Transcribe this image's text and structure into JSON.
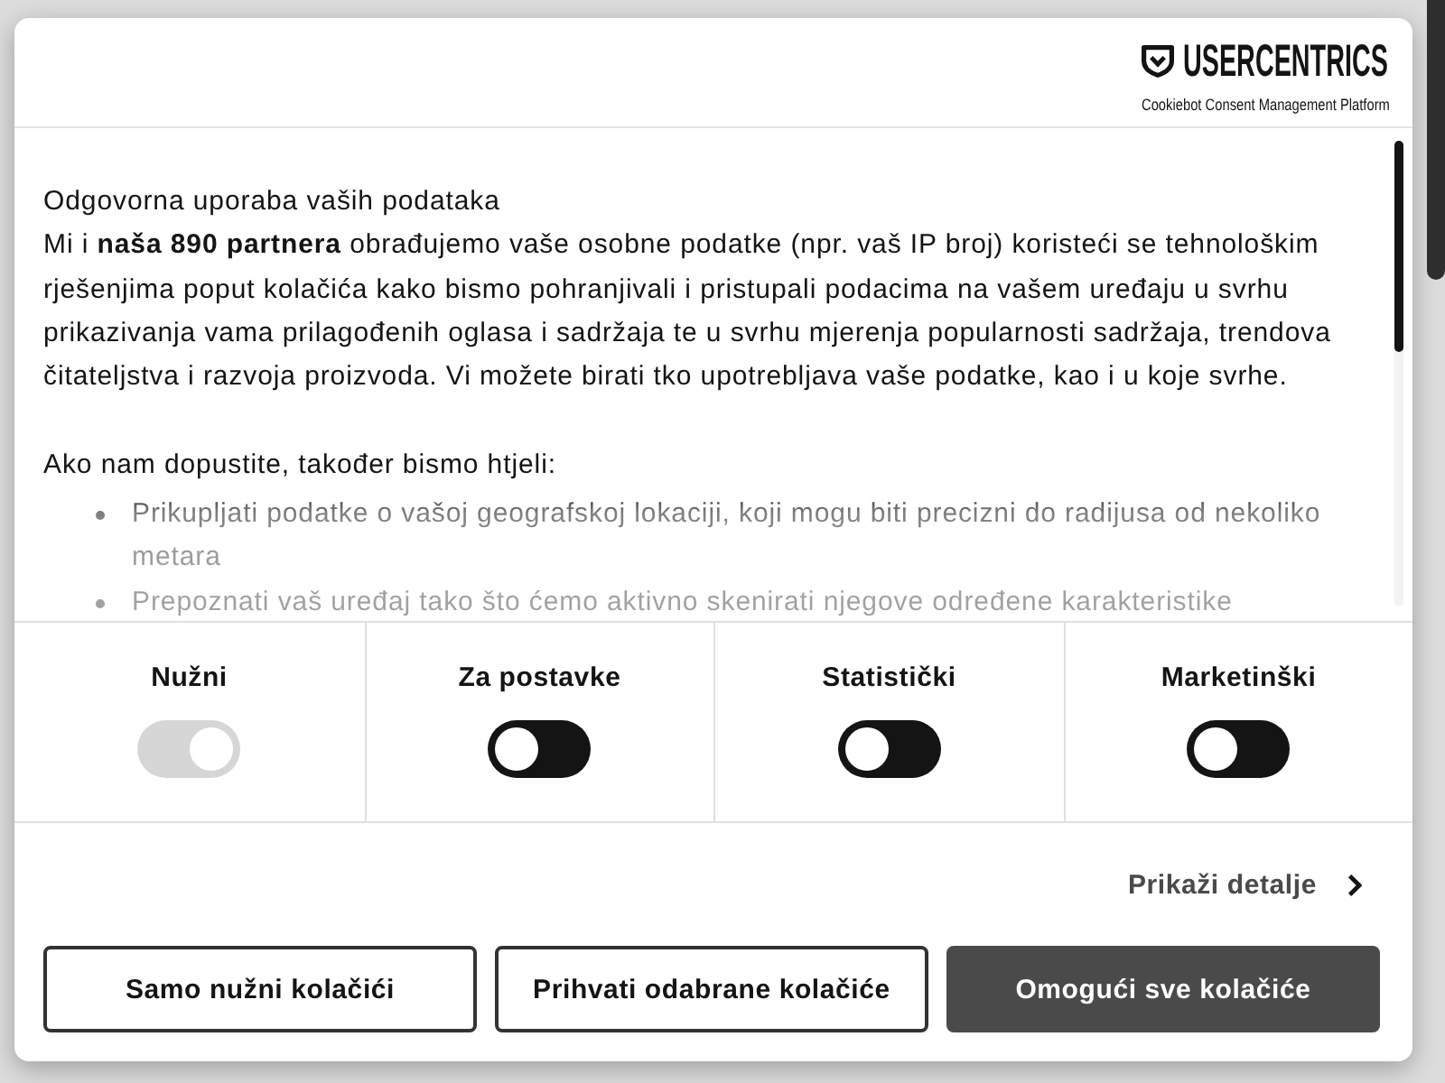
{
  "header": {
    "logo": {
      "wordmark": "USERCENTRICS",
      "tagline": "Cookiebot Consent Management Platform"
    }
  },
  "content": {
    "title": "Odgovorna uporaba vaših podataka",
    "paragraph": "Mi i **naša 890 partnera** obrađujemo vaše osobne podatke (npr. vaš IP broj) koristeći se tehnološkim rješenjima poput kolačića kako bismo pohranjivali i pristupali podacima na vašem uređaju u svrhu prikazivanja vama prilagođenih oglasa i sadržaja te u svrhu mjerenja popularnosti sadržaja, trendova čitateljstva i razvoja proizvoda. Vi možete birati tko upotrebljava vaše podatke, kao i u koje svrhe.",
    "intro": "Ako nam dopustite, također bismo htjeli:",
    "bullets": [
      "Prikupljati podatke o vašoj geografskoj lokaciji, koji mogu biti precizni do radijusa od nekoliko metara",
      "Prepoznati vaš uređaj tako što ćemo aktivno skenirati njegove određene karakteristike"
    ]
  },
  "categories": [
    {
      "label": "Nužni",
      "checked": true,
      "disabled": true
    },
    {
      "label": "Za postavke",
      "checked": false,
      "disabled": false
    },
    {
      "label": "Statistički",
      "checked": false,
      "disabled": false
    },
    {
      "label": "Marketinški",
      "checked": false,
      "disabled": false
    }
  ],
  "details_link": {
    "label": "Prikaži detalje"
  },
  "buttons": [
    {
      "label": "Samo nužni kolačići",
      "kind": "outline"
    },
    {
      "label": "Prihvati odabrane kolačiće",
      "kind": "outline"
    },
    {
      "label": "Omogući sve kolačiće",
      "kind": "filled"
    }
  ]
}
